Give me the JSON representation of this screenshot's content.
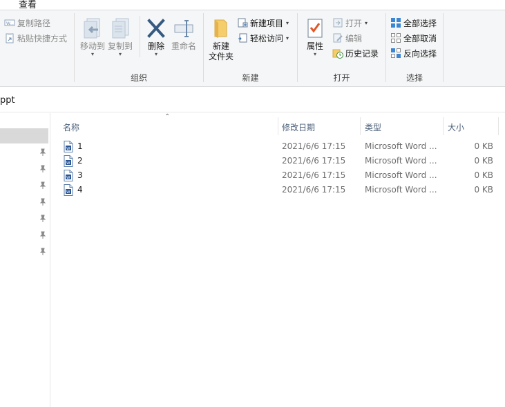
{
  "ribbon": {
    "tab_view": "查看",
    "clipboard": {
      "copy_path": "复制路径",
      "paste_shortcut": "粘贴快捷方式"
    },
    "organize": {
      "group_label": "组织",
      "move_to": "移动到",
      "copy_to": "复制到",
      "delete": "删除",
      "rename": "重命名"
    },
    "new": {
      "group_label": "新建",
      "new_folder_line1": "新建",
      "new_folder_line2": "文件夹",
      "new_item": "新建项目",
      "easy_access": "轻松访问"
    },
    "open": {
      "group_label": "打开",
      "properties": "属性",
      "open": "打开",
      "edit": "编辑",
      "history": "历史记录"
    },
    "select": {
      "group_label": "选择",
      "select_all": "全部选择",
      "select_none": "全部取消",
      "invert_selection": "反向选择"
    }
  },
  "address": {
    "path_text": "ppt"
  },
  "columns": {
    "name": "名称",
    "date": "修改日期",
    "type": "类型",
    "size": "大小"
  },
  "files": [
    {
      "name": "1",
      "date": "2021/6/6 17:15",
      "type": "Microsoft Word ...",
      "size": "0 KB"
    },
    {
      "name": "2",
      "date": "2021/6/6 17:15",
      "type": "Microsoft Word ...",
      "size": "0 KB"
    },
    {
      "name": "3",
      "date": "2021/6/6 17:15",
      "type": "Microsoft Word ...",
      "size": "0 KB"
    },
    {
      "name": "4",
      "date": "2021/6/6 17:15",
      "type": "Microsoft Word ...",
      "size": "0 KB"
    }
  ],
  "colors": {
    "ribbon_bg": "#f5f6f7",
    "header_text": "#4c607a",
    "accent_blue": "#1e73c8",
    "delete_blue": "#355a82"
  },
  "icons": {
    "copy_path": "copy-path-icon",
    "paste_shortcut": "paste-shortcut-icon",
    "move_to": "move-to-icon",
    "copy_to": "copy-to-icon",
    "delete": "delete-x-icon",
    "rename": "rename-icon",
    "new_folder": "folder-icon",
    "new_item": "new-item-icon",
    "easy_access": "easy-access-icon",
    "properties": "properties-checklist-icon",
    "open": "open-icon",
    "edit": "edit-icon",
    "history": "history-icon",
    "select_all": "select-all-icon",
    "select_none": "select-none-icon",
    "invert_selection": "invert-selection-icon",
    "pin": "pin-icon",
    "word_doc": "word-document-icon",
    "sort": "sort-up-arrow-icon"
  }
}
